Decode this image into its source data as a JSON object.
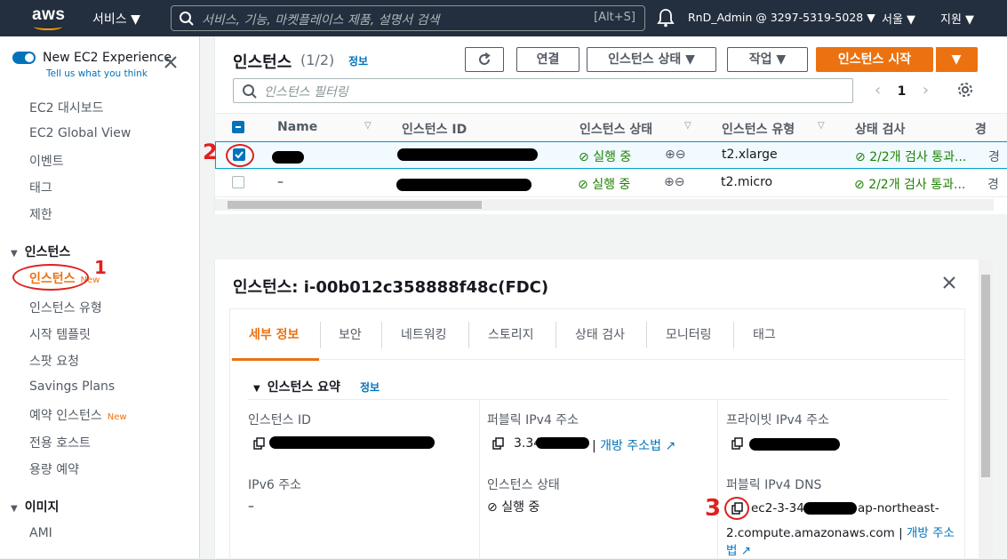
{
  "topnav": {
    "logo_text": "aws",
    "services_label": "서비스 ▼",
    "search_placeholder": "서비스, 기능, 마켓플레이스 제품, 설명서 검색",
    "search_shortcut": "[Alt+S]",
    "account_label": "RnD_Admin @ 3297-5319-5028 ▼",
    "region_label": "서울 ▼",
    "support_label": "지원 ▼"
  },
  "sidebar": {
    "experience_title": "New EC2 Experience",
    "experience_sub": "Tell us what you think",
    "items_top": [
      "EC2 대시보드",
      "EC2 Global View",
      "이벤트",
      "태그",
      "제한"
    ],
    "section_instances": "인스턴스",
    "instances_items": [
      "인스턴스",
      "인스턴스 유형",
      "시작 템플릿",
      "스팟 요청",
      "Savings Plans",
      "예약 인스턴스",
      "전용 호스트",
      "용량 예약"
    ],
    "new_badge": "New",
    "section_images": "이미지",
    "images_items": [
      "AMI"
    ]
  },
  "instances_panel": {
    "title": "인스턴스",
    "count": "(1/2)",
    "info": "정보",
    "buttons": {
      "refresh": "↻",
      "connect": "연결",
      "state": "인스턴스 상태 ▼",
      "actions": "작업 ▼",
      "launch": "인스턴스 시작",
      "launch_dd": "▼"
    },
    "filter_placeholder": "인스턴스 필터링",
    "page": "1",
    "columns": [
      "Name",
      "인스턴스 ID",
      "인스턴스 상태",
      "인스턴스 유형",
      "상태 검사",
      "경"
    ],
    "rows": [
      {
        "name": "",
        "state": "실행 중",
        "type": "t2.xlarge",
        "checks": "2/2개 검사 통과...",
        "extra": "경"
      },
      {
        "name": "–",
        "state": "실행 중",
        "type": "t2.micro",
        "checks": "2/2개 검사 통과...",
        "extra": "경"
      }
    ]
  },
  "details_panel": {
    "split_handle": "=",
    "title": "인스턴스: i-00b012c358888f48c(FDC)",
    "tabs": [
      "세부 정보",
      "보안",
      "네트워킹",
      "스토리지",
      "상태 검사",
      "모니터링",
      "태그"
    ],
    "summary_title": "인스턴스 요약",
    "summary_info": "정보",
    "instance_id_label": "인스턴스 ID",
    "public_ipv4_label": "퍼블릭 IPv4 주소",
    "public_ipv4_value": "3.34",
    "open_address": "개방 주소법",
    "private_ipv4_label": "프라이빗 IPv4 주소",
    "ipv6_label": "IPv6 주소",
    "ipv6_value": "–",
    "instance_state_label": "인스턴스 상태",
    "instance_state_value": "실행 중",
    "public_dns_label": "퍼블릭 IPv4 DNS",
    "public_dns_prefix": "ec2-3-34",
    "public_dns_suffix": "ap-northeast-",
    "public_dns_line2": "2.compute.amazonaws.com",
    "open_address_2a": "개방 주소",
    "open_address_2b": "법"
  },
  "annotations": {
    "one": "1",
    "two": "2",
    "three": "3"
  },
  "colors": {
    "accent": "#ec7211",
    "link": "#0073bb",
    "ok": "#1d8102",
    "nav": "#232f3e",
    "annotation": "#e02020"
  }
}
